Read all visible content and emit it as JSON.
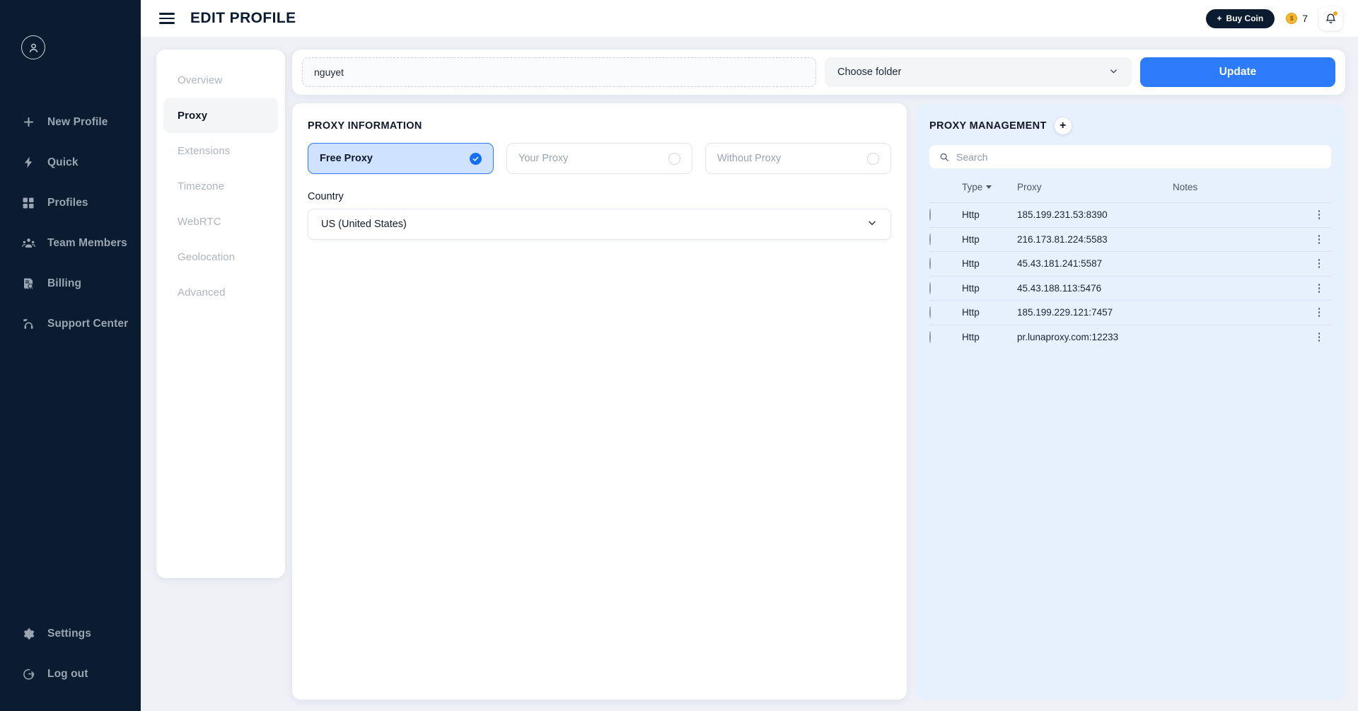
{
  "sidebar": {
    "avatar_icon": "user-circle-icon",
    "items": [
      {
        "label": "New Profile",
        "icon": "plus-icon"
      },
      {
        "label": "Quick",
        "icon": "lightning-bolt-icon"
      },
      {
        "label": "Profiles",
        "icon": "grid-squares-icon"
      },
      {
        "label": "Team Members",
        "icon": "team-members-icon"
      },
      {
        "label": "Billing",
        "icon": "billing-receipt-icon"
      },
      {
        "label": "Support Center",
        "icon": "support-headset-icon"
      }
    ],
    "bottom_items": [
      {
        "label": "Settings",
        "icon": "gear-icon"
      },
      {
        "label": "Log out",
        "icon": "logout-arrow-icon"
      }
    ]
  },
  "header": {
    "menu_icon": "hamburger-menu-icon",
    "title": "EDIT PROFILE",
    "buy_coin_label": "Buy Coin",
    "buy_coin_plus": "+",
    "coin_symbol": "$",
    "coin_count": "7",
    "bell_icon": "bell-notification-icon"
  },
  "section_nav": {
    "items": [
      {
        "label": "Overview",
        "active": false
      },
      {
        "label": "Proxy",
        "active": true
      },
      {
        "label": "Extensions",
        "active": false
      },
      {
        "label": "Timezone",
        "active": false
      },
      {
        "label": "WebRTC",
        "active": false
      },
      {
        "label": "Geolocation",
        "active": false
      },
      {
        "label": "Advanced",
        "active": false
      }
    ]
  },
  "toolbar": {
    "profile_name_value": "nguyet",
    "profile_name_placeholder": "Profile name",
    "folder_label": "Choose folder",
    "folder_chevron_icon": "chevron-down-icon",
    "update_label": "Update"
  },
  "proxy_information": {
    "title": "PROXY INFORMATION",
    "modes": [
      {
        "label": "Free Proxy",
        "selected": true
      },
      {
        "label": "Your Proxy",
        "selected": false
      },
      {
        "label": "Without Proxy",
        "selected": false
      }
    ],
    "country_label": "Country",
    "country_value": "US (United States)",
    "country_chevron_icon": "chevron-down-icon"
  },
  "proxy_management": {
    "title": "PROXY MANAGEMENT",
    "add_label": "+",
    "search_icon": "search-icon",
    "search_value": "",
    "search_placeholder": "Search",
    "columns": [
      "",
      "Type",
      "Proxy",
      "Notes",
      ""
    ],
    "type_sort_icon": "caret-down-icon",
    "rows": [
      {
        "type": "Http",
        "proxy": "185.199.231.53:8390",
        "notes": ""
      },
      {
        "type": "Http",
        "proxy": "216.173.81.224:5583",
        "notes": ""
      },
      {
        "type": "Http",
        "proxy": "45.43.181.241:5587",
        "notes": ""
      },
      {
        "type": "Http",
        "proxy": "45.43.188.113:5476",
        "notes": ""
      },
      {
        "type": "Http",
        "proxy": "185.199.229.121:7457",
        "notes": ""
      },
      {
        "type": "Http",
        "proxy": "pr.lunaproxy.com:12233",
        "notes": ""
      }
    ],
    "row_menu_icon": "kebab-menu-icon"
  },
  "colors": {
    "sidebar_bg": "#0c1c30",
    "accent_blue": "#2b7bfb",
    "panel_blue": "#e7f0fd",
    "page_bg": "#eef0f6",
    "coin_yellow": "#f5b82e"
  }
}
